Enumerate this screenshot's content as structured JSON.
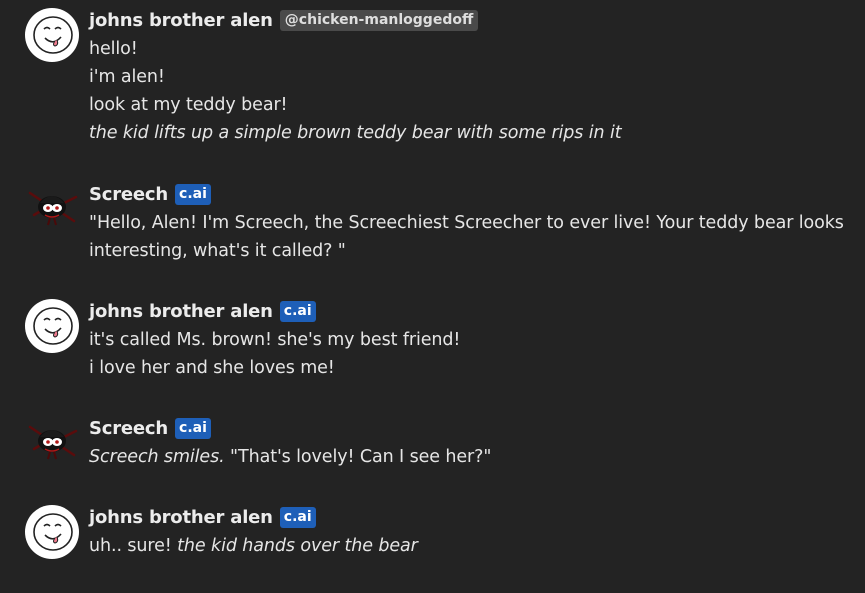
{
  "messages": [
    {
      "author": "johns brother alen",
      "avatar_icon": "smiley-face-avatar",
      "tag": "@chicken-manloggedoff",
      "tag_type": "handle",
      "lines": [
        {
          "text": "hello!"
        },
        {
          "text": "i'm alen!"
        },
        {
          "text": "look at my teddy bear!"
        },
        {
          "italic": "the kid lifts up a simple brown teddy bear with some rips in it"
        }
      ]
    },
    {
      "author": "Screech",
      "avatar_icon": "screech-creature-avatar",
      "tag": "c.ai",
      "tag_type": "badge",
      "lines": [
        {
          "text": "\"Hello, Alen! I'm Screech, the Screechiest Screecher to ever live! Your teddy bear looks interesting, what's it called? \""
        }
      ]
    },
    {
      "author": "johns brother alen",
      "avatar_icon": "smiley-face-avatar",
      "tag": "c.ai",
      "tag_type": "badge",
      "lines": [
        {
          "text": "it's called Ms. brown! she's my best friend!"
        },
        {
          "text": "i love her and she loves me!"
        }
      ]
    },
    {
      "author": "Screech",
      "avatar_icon": "screech-creature-avatar",
      "tag": "c.ai",
      "tag_type": "badge",
      "lines": [
        {
          "italic": "Screech smiles.",
          "text": "\"That's lovely! Can I see her?\""
        }
      ]
    },
    {
      "author": "johns brother alen",
      "avatar_icon": "smiley-face-avatar",
      "tag": "c.ai",
      "tag_type": "badge",
      "lines": [
        {
          "text": "uh.. sure!",
          "italic": "the kid hands over the bear"
        }
      ]
    }
  ],
  "colors": {
    "background": "#232323",
    "text": "#e6e6e6",
    "badge": "#1e5fb8",
    "handle": "#4a4a4a"
  }
}
